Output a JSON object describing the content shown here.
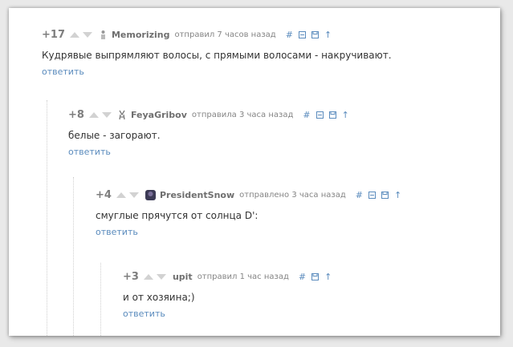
{
  "comments": [
    {
      "rating": "+17",
      "user": "Memorizing",
      "time": "отправил 7 часов назад",
      "text": "Кудрявые выпрямляют волосы, с прямыми волосами - накручивают.",
      "reply": "ответить",
      "tools": [
        "#",
        "collapse",
        "save",
        "↑"
      ]
    },
    {
      "rating": "+8",
      "user": "FeyaGribov",
      "time": "отправила 3 часа назад",
      "text": "белые - загорают.",
      "reply": "ответить",
      "tools": [
        "#",
        "collapse",
        "save",
        "↑"
      ]
    },
    {
      "rating": "+4",
      "user": "PresidentSnow",
      "time": "отправлено 3 часа назад",
      "text": "смуглые прячутся от солнца D':",
      "reply": "ответить",
      "tools": [
        "#",
        "collapse",
        "save",
        "↑"
      ]
    },
    {
      "rating": "+3",
      "user": "upit",
      "time": "отправил 1 час назад",
      "text": "и от хозяина;)",
      "reply": "ответить",
      "tools": [
        "#",
        "save",
        "↑"
      ]
    }
  ],
  "colors": {
    "link": "#5a8bbd",
    "rating": "#7e7e7e",
    "text": "#333333"
  }
}
